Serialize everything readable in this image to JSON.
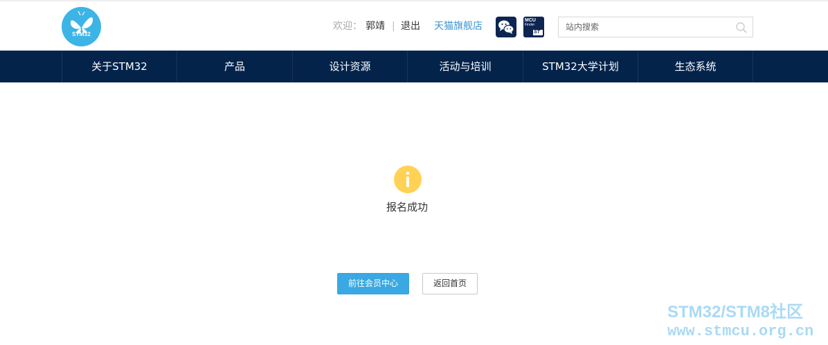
{
  "header": {
    "logo_text": "STM32",
    "welcome": "欢迎：",
    "username": "郭靖",
    "separator": "|",
    "logout": "退出",
    "tmall_store": "天猫旗舰店",
    "mcu_finder_line1": "MCU",
    "mcu_finder_line2": "Finder",
    "mcu_finder_brand": "ST",
    "search_placeholder": "站内搜索",
    "search_value": ""
  },
  "nav": {
    "items": [
      {
        "label": "关于STM32"
      },
      {
        "label": "产品"
      },
      {
        "label": "设计资源"
      },
      {
        "label": "活动与培训"
      },
      {
        "label": "STM32大学计划"
      },
      {
        "label": "生态系统"
      }
    ]
  },
  "main": {
    "message": "报名成功",
    "primary_button": "前往会员中心",
    "secondary_button": "返回首页"
  },
  "watermark": {
    "line1": "STM32/STM8社区",
    "line2": "www.stmcu.org.cn"
  },
  "colors": {
    "brand_blue": "#3cb4e6",
    "nav_background": "#03234b",
    "primary_button": "#3aa8e2",
    "info_icon": "#ffd255",
    "link_blue": "#3a96d0"
  },
  "icons": {
    "logo": "butterfly-logo-icon",
    "wechat": "wechat-icon",
    "mcu_finder": "mcu-finder-icon",
    "search": "search-icon",
    "info": "info-icon"
  }
}
